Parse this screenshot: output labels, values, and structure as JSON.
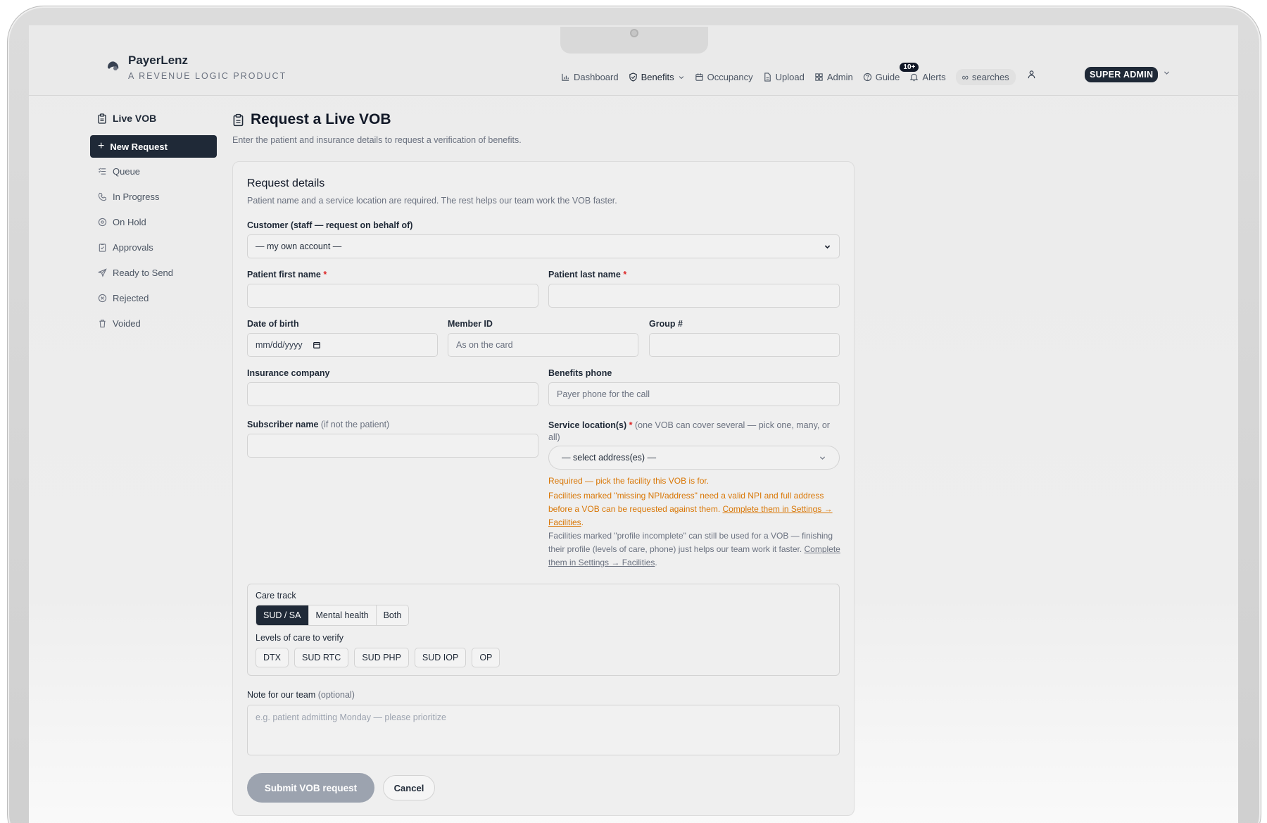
{
  "brand": {
    "name": "PayerLenz",
    "tagline": "A REVENUE LOGIC PRODUCT"
  },
  "nav": {
    "dashboard": "Dashboard",
    "benefits": "Benefits",
    "occupancy": "Occupancy",
    "upload": "Upload",
    "admin": "Admin",
    "guide": "Guide",
    "alerts_count": "10+",
    "alerts": "Alerts",
    "searches": "searches",
    "role": "SUPER ADMIN"
  },
  "sidebar": {
    "title": "Live VOB",
    "items": [
      {
        "label": "New Request"
      },
      {
        "label": "Queue"
      },
      {
        "label": "In Progress"
      },
      {
        "label": "On Hold"
      },
      {
        "label": "Approvals"
      },
      {
        "label": "Ready to Send"
      },
      {
        "label": "Rejected"
      },
      {
        "label": "Voided"
      }
    ]
  },
  "page": {
    "title": "Request a Live VOB",
    "subtitle": "Enter the patient and insurance details to request a verification of benefits."
  },
  "form": {
    "section_title": "Request details",
    "section_sub": "Patient name and a service location are required. The rest helps our team work the VOB faster.",
    "customer_label": "Customer (staff — request on behalf of)",
    "customer_value": "— my own account —",
    "first_name_label": "Patient first name",
    "last_name_label": "Patient last name",
    "required_mark": "*",
    "dob_label": "Date of birth",
    "dob_placeholder": "mm/dd/yyyy",
    "member_id_label": "Member ID",
    "member_id_placeholder": "As on the card",
    "group_label": "Group #",
    "insurance_label": "Insurance company",
    "benefits_phone_label": "Benefits phone",
    "benefits_phone_placeholder": "Payer phone for the call",
    "subscriber_label": "Subscriber name",
    "subscriber_note": "(if not the patient)",
    "service_label": "Service location(s)",
    "service_note": "(one VOB can cover several — pick one, many, or all)",
    "service_value": "— select address(es) —",
    "warn_required": "Required — pick the facility this VOB is for.",
    "warn_missing_text": "Facilities marked \"missing NPI/address\" need a valid NPI and full address before a VOB can be requested against them. ",
    "warn_missing_link": "Complete them in Settings → Facilities",
    "warn_missing_end": ".",
    "info_incomplete_text": "Facilities marked \"profile incomplete\" can still be used for a VOB — finishing their profile (levels of care, phone) just helps our team work it faster. ",
    "info_incomplete_link": "Complete them in Settings → Facilities",
    "info_incomplete_end": ".",
    "care_track_label": "Care track",
    "care_track_options": [
      "SUD / SA",
      "Mental health",
      "Both"
    ],
    "care_track_selected": "SUD / SA",
    "levels_label": "Levels of care to verify",
    "levels": [
      "DTX",
      "SUD RTC",
      "SUD PHP",
      "SUD IOP",
      "OP"
    ],
    "note_label": "Note for our team",
    "note_optional": "(optional)",
    "note_placeholder": "e.g. patient admitting Monday — please prioritize",
    "submit": "Submit VOB request",
    "cancel": "Cancel"
  },
  "colors": {
    "primary_dark": "#1f2937",
    "warning": "#d97706",
    "required": "#dc2626",
    "disabled_button": "#9ca3af"
  }
}
